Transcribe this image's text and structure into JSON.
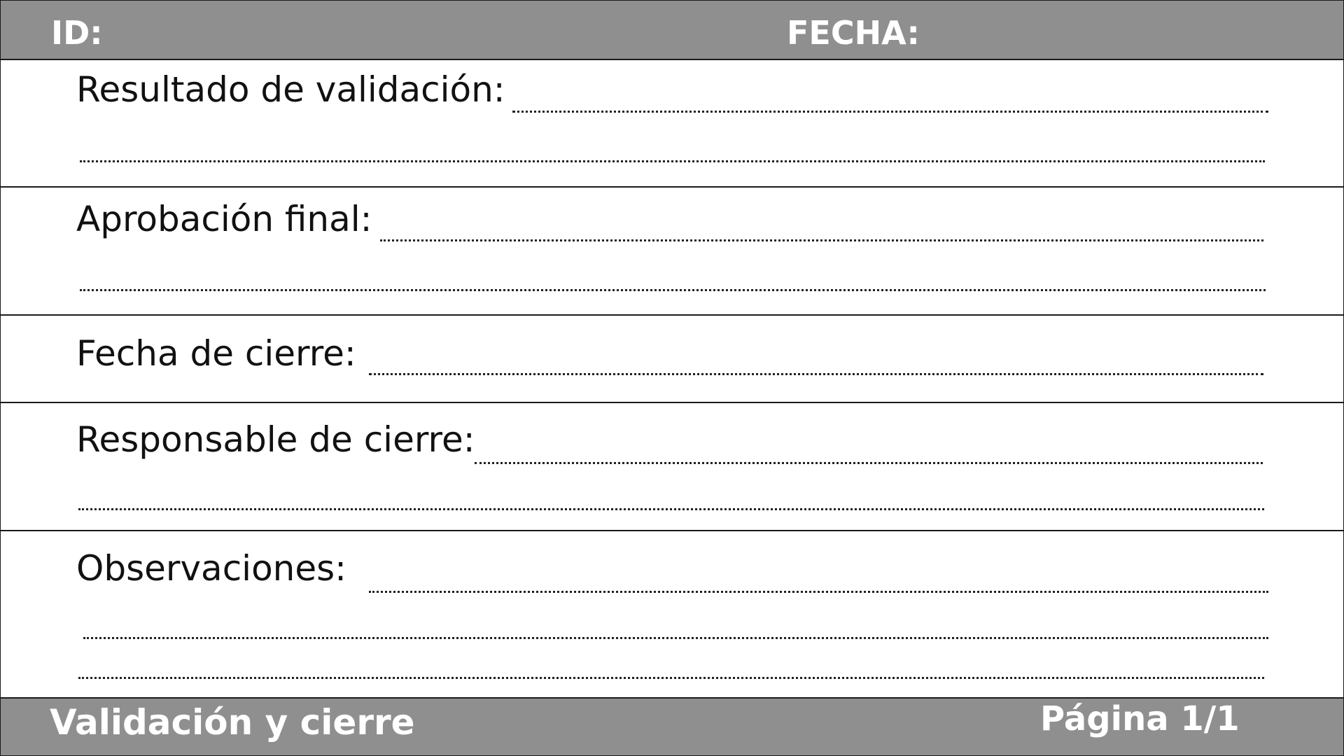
{
  "header": {
    "id_label": "ID:",
    "date_label": "FECHA:"
  },
  "fields": {
    "validation_result": "Resultado de validación:",
    "final_approval": "Aprobación final:",
    "closing_date": "Fecha de cierre:",
    "closing_owner": "Responsable de cierre:",
    "observations": "Observaciones:"
  },
  "footer": {
    "title": "Validación y cierre",
    "page": "Página 1/1"
  },
  "colors": {
    "bar_background": "#8f8f8f",
    "bar_text": "#ffffff",
    "rule": "#1a1a1a"
  }
}
